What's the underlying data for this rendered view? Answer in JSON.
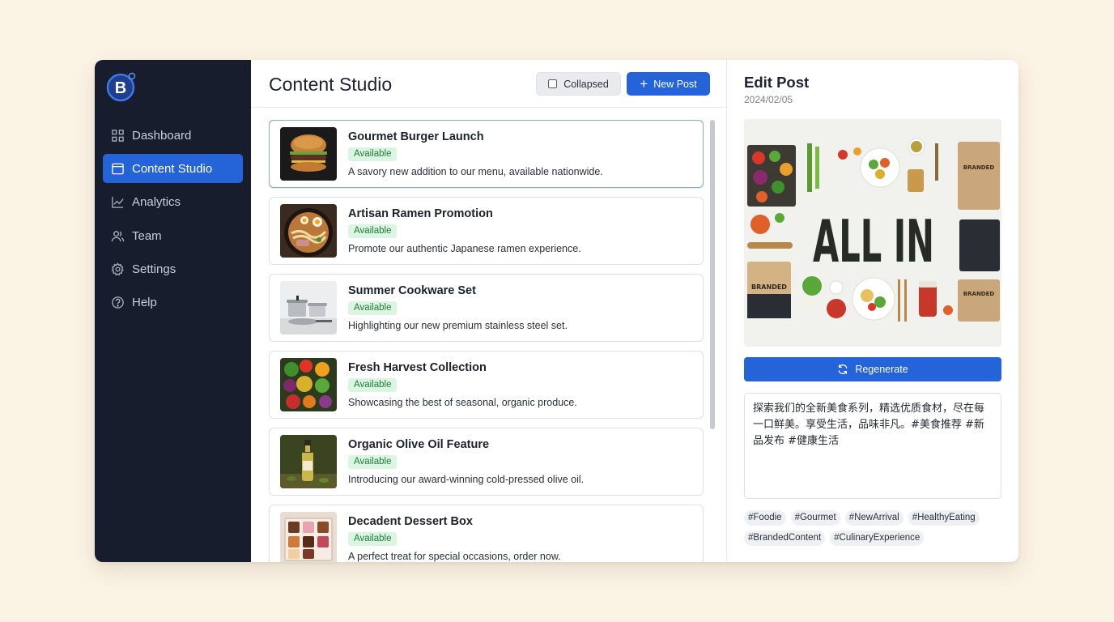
{
  "colors": {
    "background": "#fbf3e4",
    "sidebar": "#181d2e",
    "accent": "#2563d9",
    "badge_bg": "#dcf5e3",
    "badge_text": "#1e7a3c"
  },
  "sidebar": {
    "logo_icon": "brand-b-logo",
    "items": [
      {
        "label": "Dashboard",
        "icon": "grid-icon",
        "active": false
      },
      {
        "label": "Content Studio",
        "icon": "window-icon",
        "active": true
      },
      {
        "label": "Analytics",
        "icon": "chart-icon",
        "active": false
      },
      {
        "label": "Team",
        "icon": "users-icon",
        "active": false
      },
      {
        "label": "Settings",
        "icon": "gear-icon",
        "active": false
      },
      {
        "label": "Help",
        "icon": "help-icon",
        "active": false
      }
    ]
  },
  "header": {
    "title": "Content Studio",
    "collapsed_label": "Collapsed",
    "new_post_label": "New Post"
  },
  "posts": [
    {
      "title": "Gourmet Burger Launch",
      "status": "Available",
      "description": "A savory new addition to our menu, available nationwide.",
      "thumb": "burger-image"
    },
    {
      "title": "Artisan Ramen Promotion",
      "status": "Available",
      "description": "Promote our authentic Japanese ramen experience.",
      "thumb": "ramen-image"
    },
    {
      "title": "Summer Cookware Set",
      "status": "Available",
      "description": "Highlighting our new premium stainless steel set.",
      "thumb": "cookware-image"
    },
    {
      "title": "Fresh Harvest Collection",
      "status": "Available",
      "description": "Showcasing the best of seasonal, organic produce.",
      "thumb": "produce-image"
    },
    {
      "title": "Organic Olive Oil Feature",
      "status": "Available",
      "description": "Introducing our award-winning cold-pressed olive oil.",
      "thumb": "olive-oil-image"
    },
    {
      "title": "Decadent Dessert Box",
      "status": "Available",
      "description": "A perfect treat for special occasions, order now.",
      "thumb": "dessert-image"
    }
  ],
  "editor": {
    "title": "Edit Post",
    "date": "2024/02/05",
    "preview_text": "ALL IN",
    "preview_labels": [
      "BRANDED",
      "BRANDED",
      "BRANDED"
    ],
    "regenerate_label": "Regenerate",
    "caption": "探索我们的全新美食系列，精选优质食材，尽在每一口鲜美。享受生活，品味非凡。#美食推荐 #新品发布 #健康生活",
    "tags": [
      "#Foodie",
      "#Gourmet",
      "#NewArrival",
      "#HealthyEating",
      "#BrandedContent",
      "#CulinaryExperience"
    ]
  }
}
